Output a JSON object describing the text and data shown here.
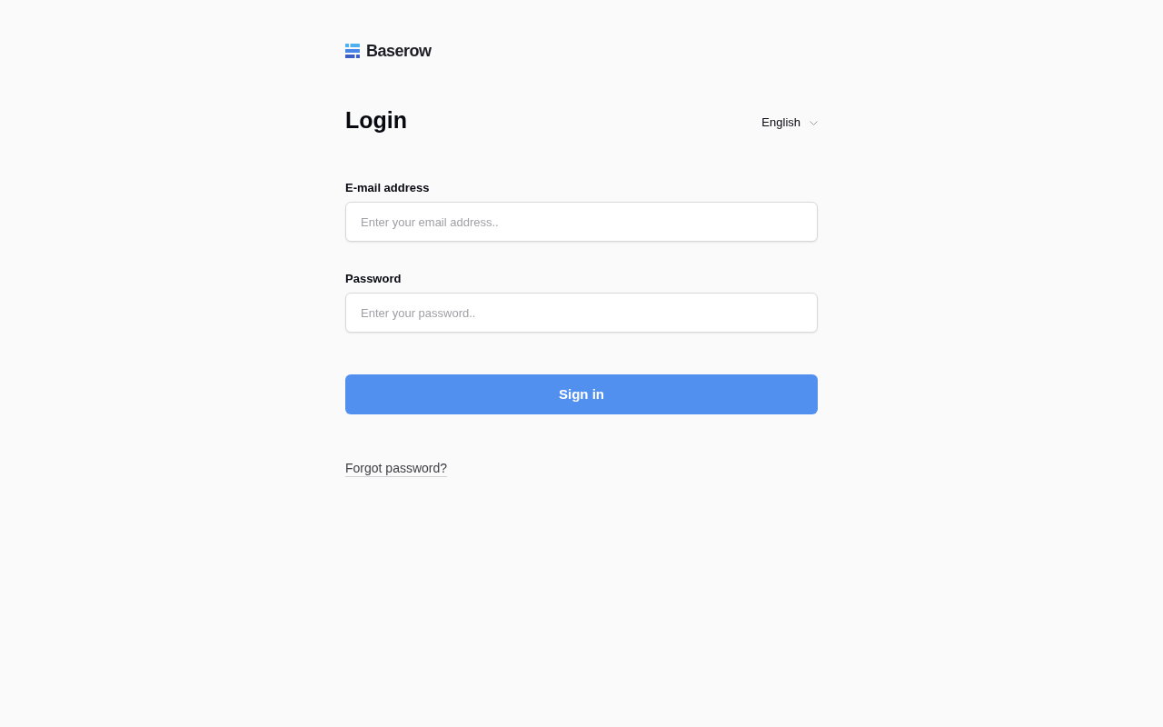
{
  "logo": {
    "text": "Baserow"
  },
  "header": {
    "title": "Login",
    "language": {
      "value": "English"
    }
  },
  "fields": [
    {
      "label": "E-mail address",
      "placeholder": "Enter your email address.."
    },
    {
      "label": "Password",
      "placeholder": "Enter your password.."
    }
  ],
  "submit_button": {
    "label": "Sign in"
  },
  "forgot_link": {
    "label": "Forgot password?"
  }
}
